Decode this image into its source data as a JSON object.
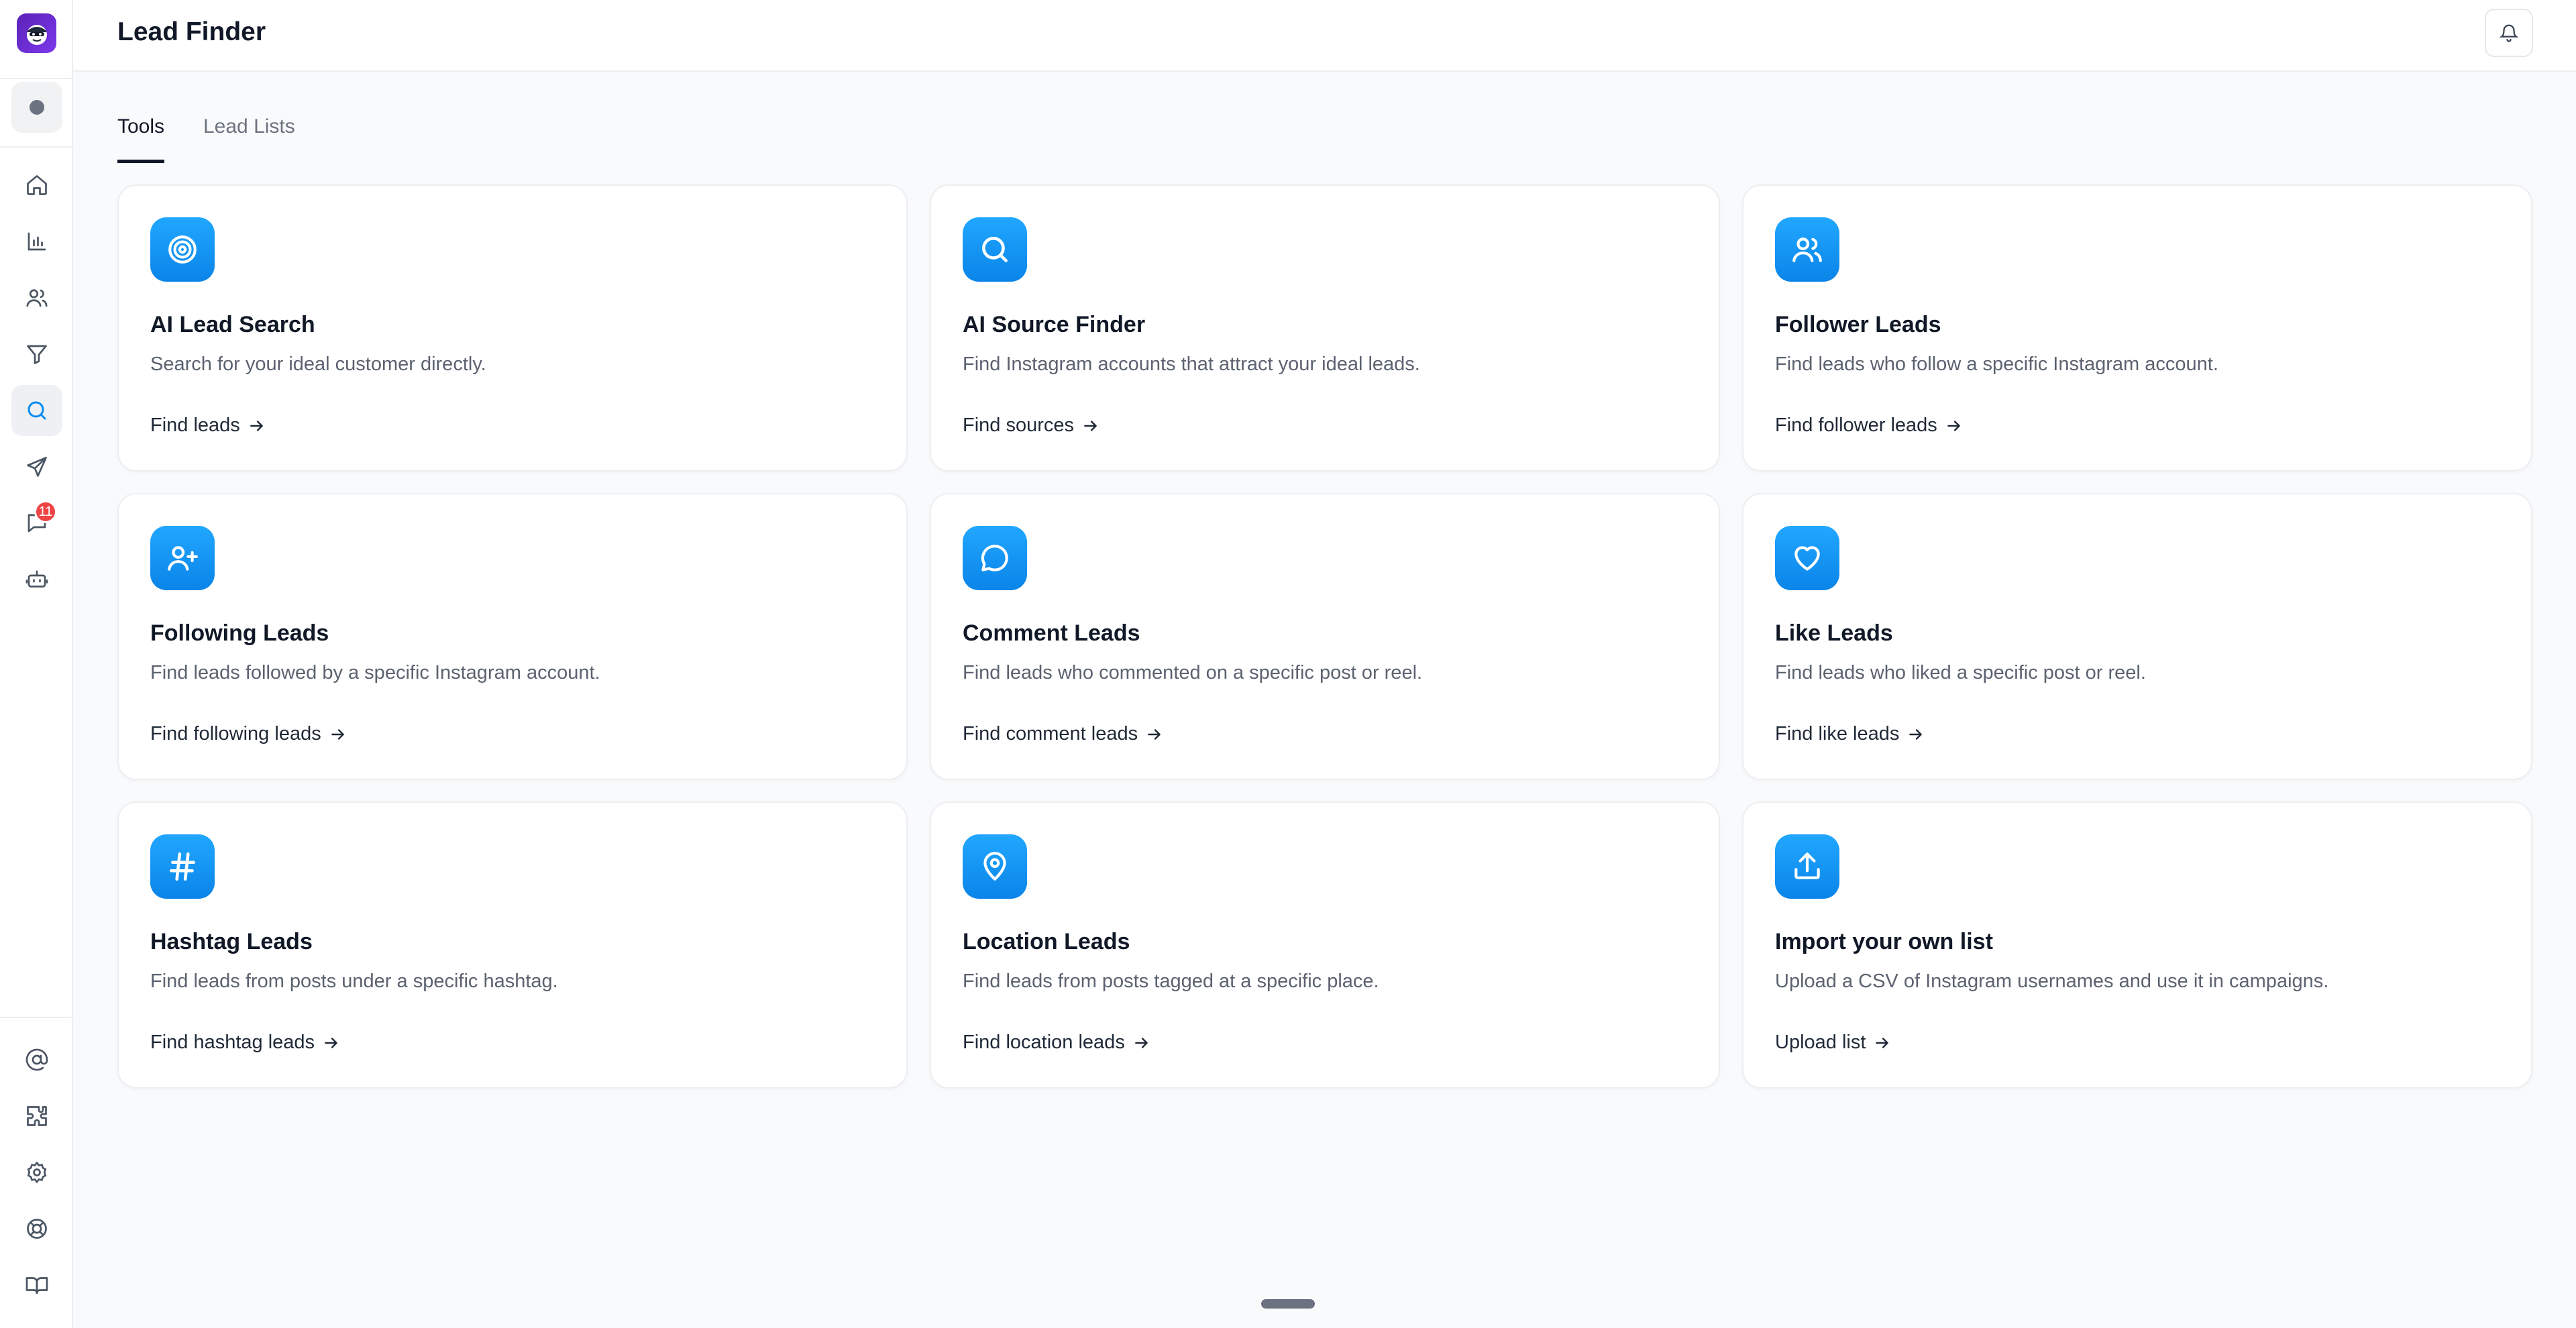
{
  "header": {
    "title": "Lead Finder",
    "bell_icon": "bell-icon"
  },
  "sidebar": {
    "badge_count": "11",
    "nav": [
      {
        "name": "home",
        "icon": "home-icon"
      },
      {
        "name": "analytics",
        "icon": "bar-chart-icon"
      },
      {
        "name": "contacts",
        "icon": "users-icon"
      },
      {
        "name": "filters",
        "icon": "funnel-icon"
      },
      {
        "name": "lead-finder",
        "icon": "search-icon",
        "active": true
      },
      {
        "name": "campaigns",
        "icon": "send-icon"
      },
      {
        "name": "messages",
        "icon": "chat-icon"
      },
      {
        "name": "automations",
        "icon": "bot-icon"
      }
    ],
    "bottom": [
      {
        "name": "mentions",
        "icon": "at-sign-icon"
      },
      {
        "name": "integrations",
        "icon": "puzzle-icon"
      },
      {
        "name": "settings",
        "icon": "gear-icon"
      },
      {
        "name": "support",
        "icon": "lifebuoy-icon"
      },
      {
        "name": "docs",
        "icon": "book-icon"
      }
    ]
  },
  "tabs": [
    {
      "label": "Tools",
      "active": true
    },
    {
      "label": "Lead Lists",
      "active": false
    }
  ],
  "cards": [
    {
      "icon": "target-icon",
      "title": "AI Lead Search",
      "desc": "Search for your ideal customer directly.",
      "link": "Find leads"
    },
    {
      "icon": "search-icon",
      "title": "AI Source Finder",
      "desc": "Find Instagram accounts that attract your ideal leads.",
      "link": "Find sources"
    },
    {
      "icon": "users-icon",
      "title": "Follower Leads",
      "desc": "Find leads who follow a specific Instagram account.",
      "link": "Find follower leads"
    },
    {
      "icon": "user-plus-icon",
      "title": "Following Leads",
      "desc": "Find leads followed by a specific Instagram account.",
      "link": "Find following leads"
    },
    {
      "icon": "comment-icon",
      "title": "Comment Leads",
      "desc": "Find leads who commented on a specific post or reel.",
      "link": "Find comment leads"
    },
    {
      "icon": "heart-icon",
      "title": "Like Leads",
      "desc": "Find leads who liked a specific post or reel.",
      "link": "Find like leads"
    },
    {
      "icon": "hashtag-icon",
      "title": "Hashtag Leads",
      "desc": "Find leads from posts under a specific hashtag.",
      "link": "Find hashtag leads"
    },
    {
      "icon": "map-pin-icon",
      "title": "Location Leads",
      "desc": "Find leads from posts tagged at a specific place.",
      "link": "Find location leads"
    },
    {
      "icon": "upload-icon",
      "title": "Import your own list",
      "desc": "Upload a CSV of Instagram usernames and use it in campaigns.",
      "link": "Upload list"
    }
  ],
  "colors": {
    "accent": "#0a8cf0",
    "badge": "#ef4444",
    "logo": "#6d28d9"
  }
}
